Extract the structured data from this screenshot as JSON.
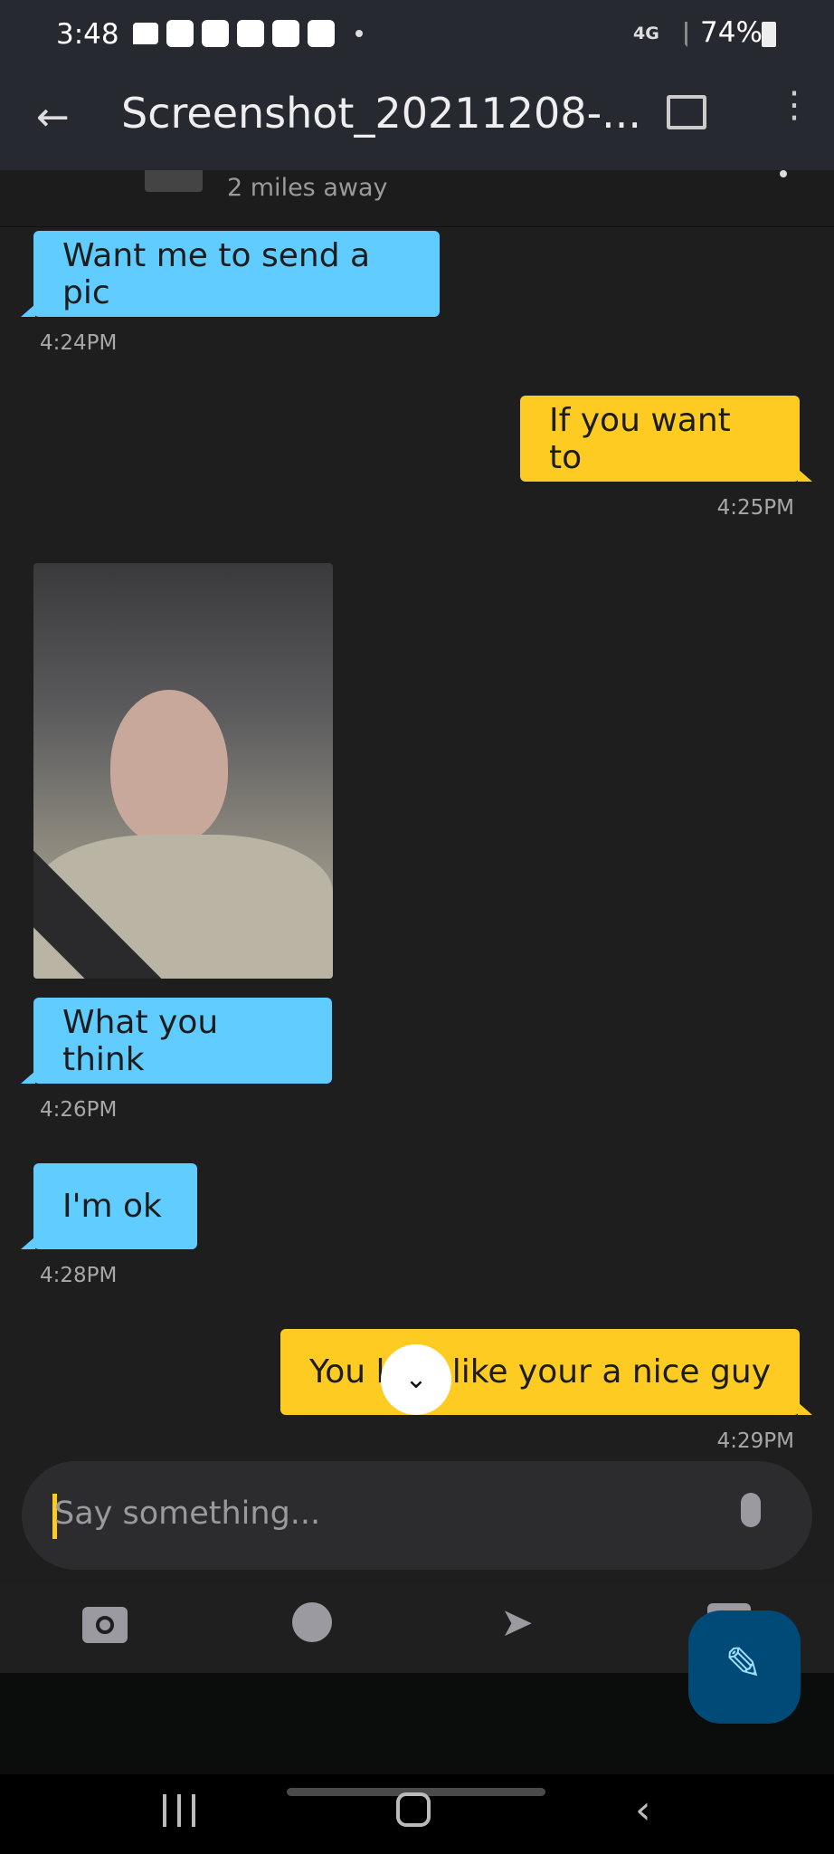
{
  "status_bar": {
    "time": "3:48",
    "network": "4G",
    "battery": "74%"
  },
  "app_bar": {
    "title": "Screenshot_20211208-..."
  },
  "profile": {
    "distance": "2 miles away"
  },
  "messages": [
    {
      "side": "in",
      "text": "Want me to send a pic",
      "time": "4:24PM"
    },
    {
      "side": "out",
      "text": "If you want to",
      "time": "4:25PM"
    },
    {
      "side": "in",
      "type": "photo",
      "time": ""
    },
    {
      "side": "in",
      "text": "What you think",
      "time": "4:26PM"
    },
    {
      "side": "in",
      "text": "I'm ok",
      "time": "4:28PM"
    },
    {
      "side": "out",
      "text_before": "You l",
      "text_after": "like your a nice guy",
      "time": "4:29PM"
    }
  ],
  "composer": {
    "placeholder": "Say something..."
  },
  "colors": {
    "incoming": "#60ccff",
    "outgoing": "#fdcb22",
    "fab": "#004a78"
  }
}
